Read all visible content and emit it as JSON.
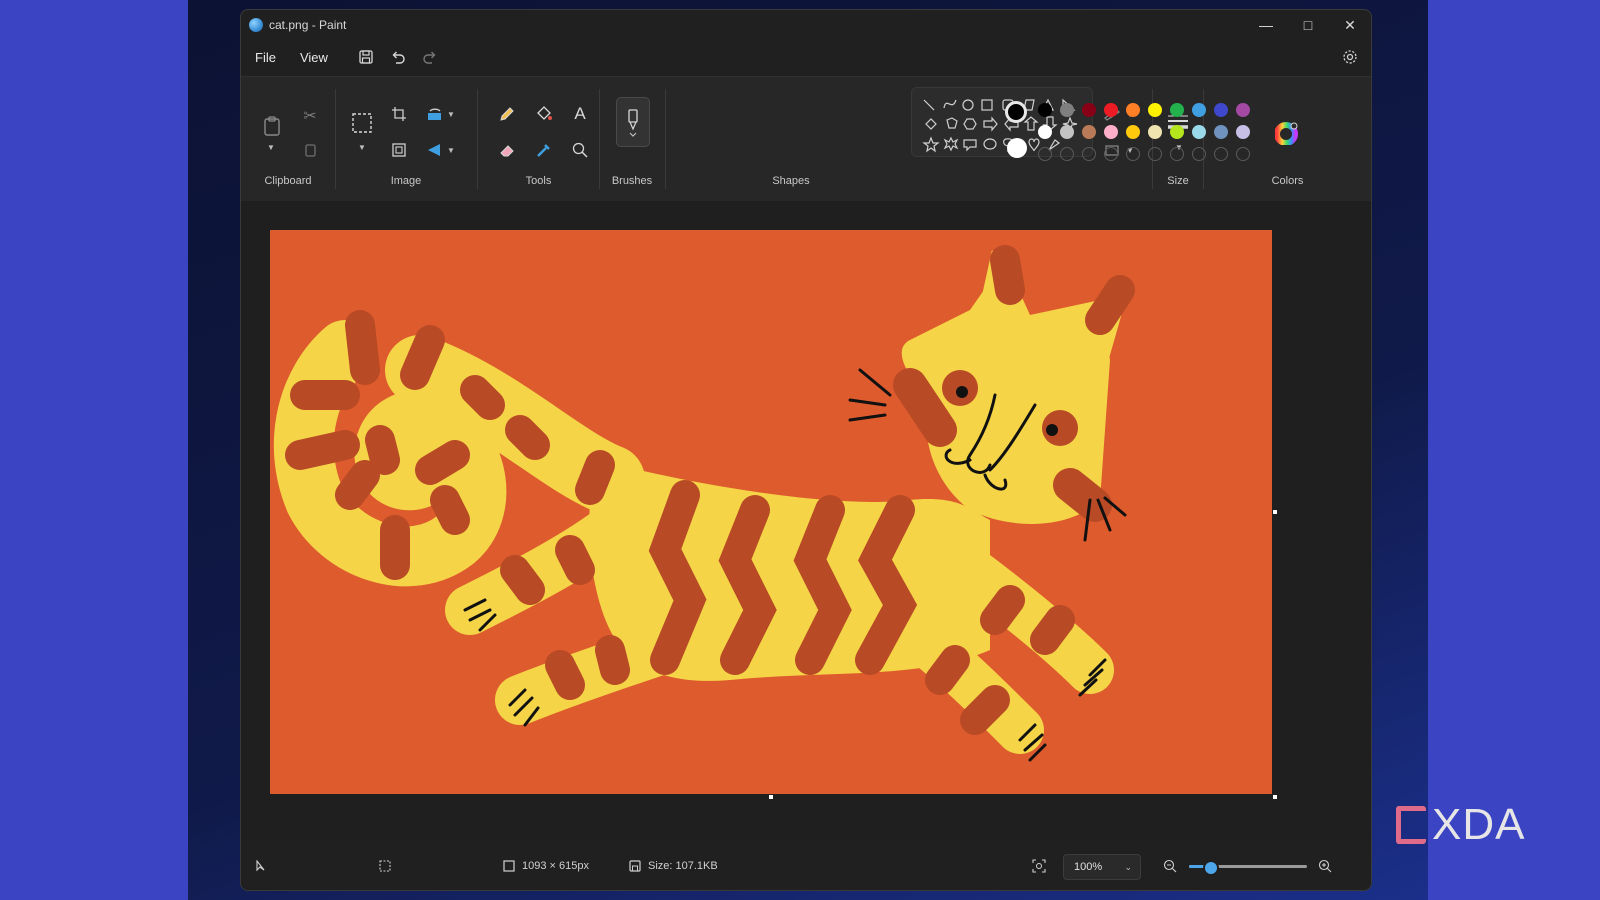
{
  "window": {
    "title": "cat.png - Paint"
  },
  "menu": {
    "file": "File",
    "view": "View"
  },
  "ribbon": {
    "groups": {
      "clipboard": "Clipboard",
      "image": "Image",
      "tools": "Tools",
      "brushes": "Brushes",
      "shapes": "Shapes",
      "size": "Size",
      "colors": "Colors"
    }
  },
  "colors": {
    "primary": "#000000",
    "secondary": "#ffffff",
    "palette_row1": [
      "#000000",
      "#7f7f7f",
      "#880015",
      "#ed1c24",
      "#ff7f27",
      "#fff200",
      "#22b14c",
      "#3f9fe0",
      "#3f48cc",
      "#a349a4"
    ],
    "palette_row2": [
      "#ffffff",
      "#c3c3c3",
      "#b97a57",
      "#ffaec9",
      "#ffc90e",
      "#efe4b0",
      "#b5e61d",
      "#99d9ea",
      "#7092be",
      "#c8bfe7"
    ]
  },
  "status": {
    "dimensions": "1093 × 615px",
    "size": "Size: 107.1KB",
    "zoom": "100%",
    "zoom_fraction": 0.18
  },
  "watermark": {
    "text": "XDA"
  }
}
